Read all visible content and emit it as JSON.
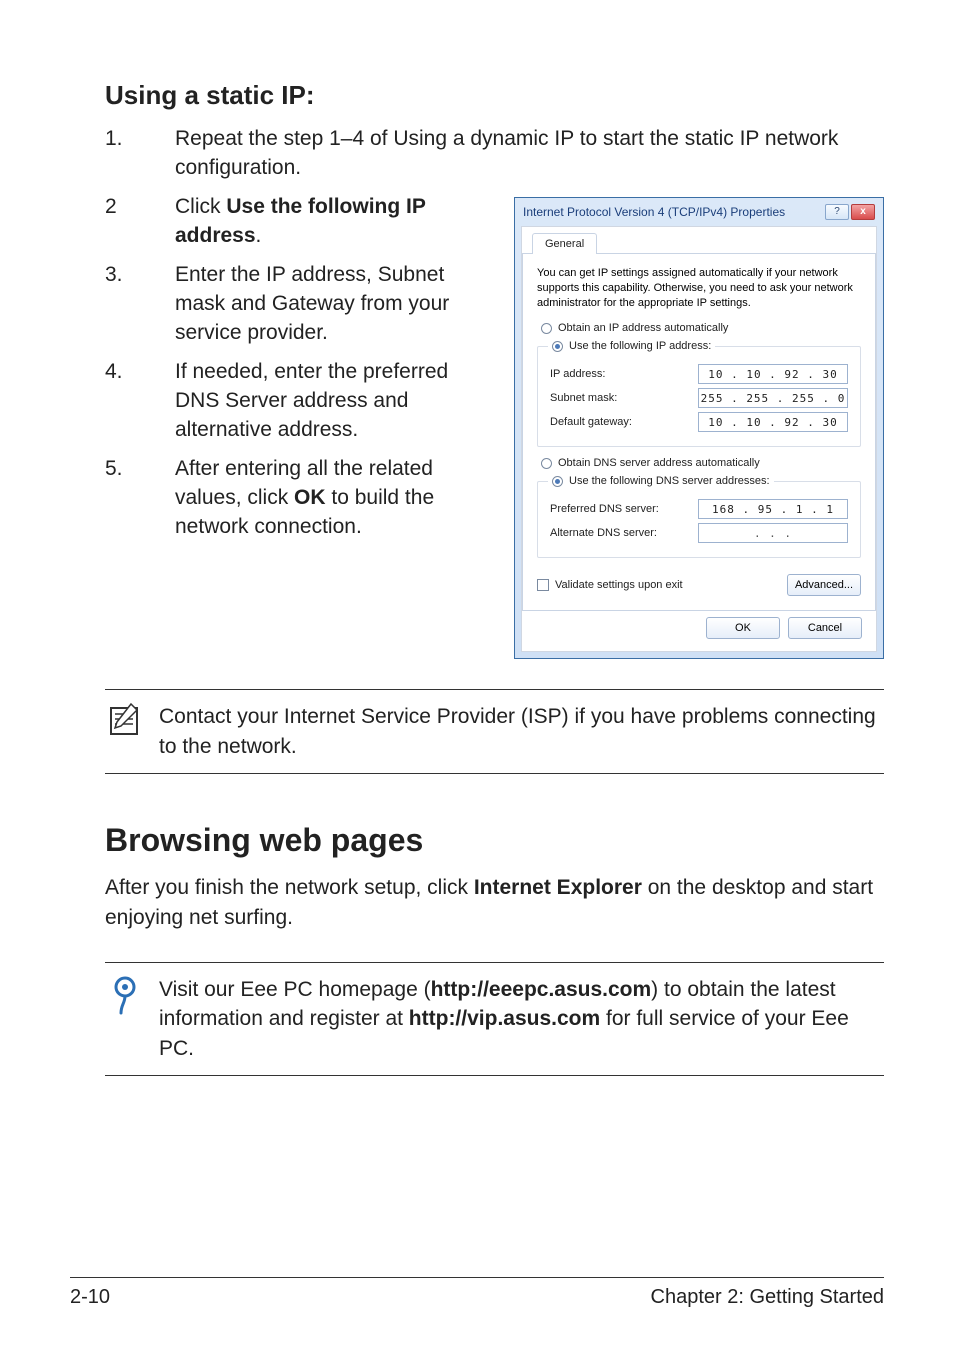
{
  "headings": {
    "static_ip": "Using a static IP:",
    "browsing": "Browsing web pages"
  },
  "steps_full": {
    "s1_num": "1.",
    "s1_txt_a": "Repeat the step 1–4 of Using a dynamic IP to start the static IP network configuration."
  },
  "steps_left": {
    "s2_num": "2",
    "s2_txt_a": "Click ",
    "s2_txt_b": "Use the following IP address",
    "s2_txt_c": ".",
    "s3_num": "3.",
    "s3_txt": "Enter the IP address, Subnet mask and Gateway from your service provider.",
    "s4_num": "4.",
    "s4_txt": "If needed, enter the preferred DNS Server address and alternative address.",
    "s5_num": "5.",
    "s5_txt_a": "After entering all the related values, click ",
    "s5_txt_b": "OK",
    "s5_txt_c": " to build the network connection."
  },
  "callout1": "Contact your Internet Service Provider (ISP) if you have problems connecting to the network.",
  "browsing_para_a": "After you finish the network setup, click ",
  "browsing_para_b": "Internet Explorer",
  "browsing_para_c": " on the desktop and start enjoying net surfing.",
  "callout2_a": "Visit our Eee PC homepage (",
  "callout2_b": "http://eeepc.asus.com",
  "callout2_c": ") to obtain the latest information and register at ",
  "callout2_d": "http://vip.asus.com",
  "callout2_e": " for full service of your Eee PC.",
  "footer": {
    "left": "2-10",
    "right": "Chapter 2: Getting Started"
  },
  "dialog": {
    "title": "Internet Protocol Version 4 (TCP/IPv4) Properties",
    "tab": "General",
    "desc": "You can get IP settings assigned automatically if your network supports this capability. Otherwise, you need to ask your network administrator for the appropriate IP settings.",
    "r1": "Obtain an IP address automatically",
    "r2": "Use the following IP address:",
    "ip_lbl": "IP address:",
    "ip_val": "10 . 10 . 92 . 30",
    "sn_lbl": "Subnet mask:",
    "sn_val": "255 . 255 . 255 . 0",
    "gw_lbl": "Default gateway:",
    "gw_val": "10 . 10 . 92 . 30",
    "r3": "Obtain DNS server address automatically",
    "r4": "Use the following DNS server addresses:",
    "pdns_lbl": "Preferred DNS server:",
    "pdns_val": "168 . 95 . 1 . 1",
    "adns_lbl": "Alternate DNS server:",
    "adns_val": ".       .       .",
    "validate": "Validate settings upon exit",
    "advanced": "Advanced...",
    "ok": "OK",
    "cancel": "Cancel",
    "help": "?",
    "close": "x"
  }
}
